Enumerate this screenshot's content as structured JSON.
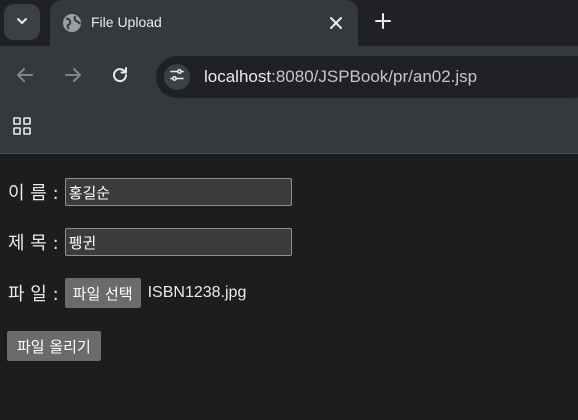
{
  "browser": {
    "tab": {
      "title": "File Upload"
    },
    "address_bar": {
      "host": "localhost",
      "rest": ":8080/JSPBook/pr/an02.jsp"
    },
    "icons": {
      "tab_menu": "chevron-down-icon",
      "favicon": "globe-icon",
      "close": "close-icon",
      "new_tab": "plus-icon",
      "back": "arrow-left-icon",
      "forward": "arrow-right-icon",
      "reload": "reload-icon",
      "site_info": "tune-icon",
      "apps": "apps-grid-icon"
    },
    "colors": {
      "tabstrip": "#202124",
      "toolbar": "#35393d",
      "page_background": "#1c1d1f"
    }
  },
  "form": {
    "name_label": "이 름 :",
    "name_value": "홍길순",
    "title_label": "제 목 :",
    "title_value": "펭귄",
    "file_label": "파 일 :",
    "file_button_label": "파일 선택",
    "file_name": "ISBN1238.jpg",
    "submit_label": "파일 올리기"
  }
}
